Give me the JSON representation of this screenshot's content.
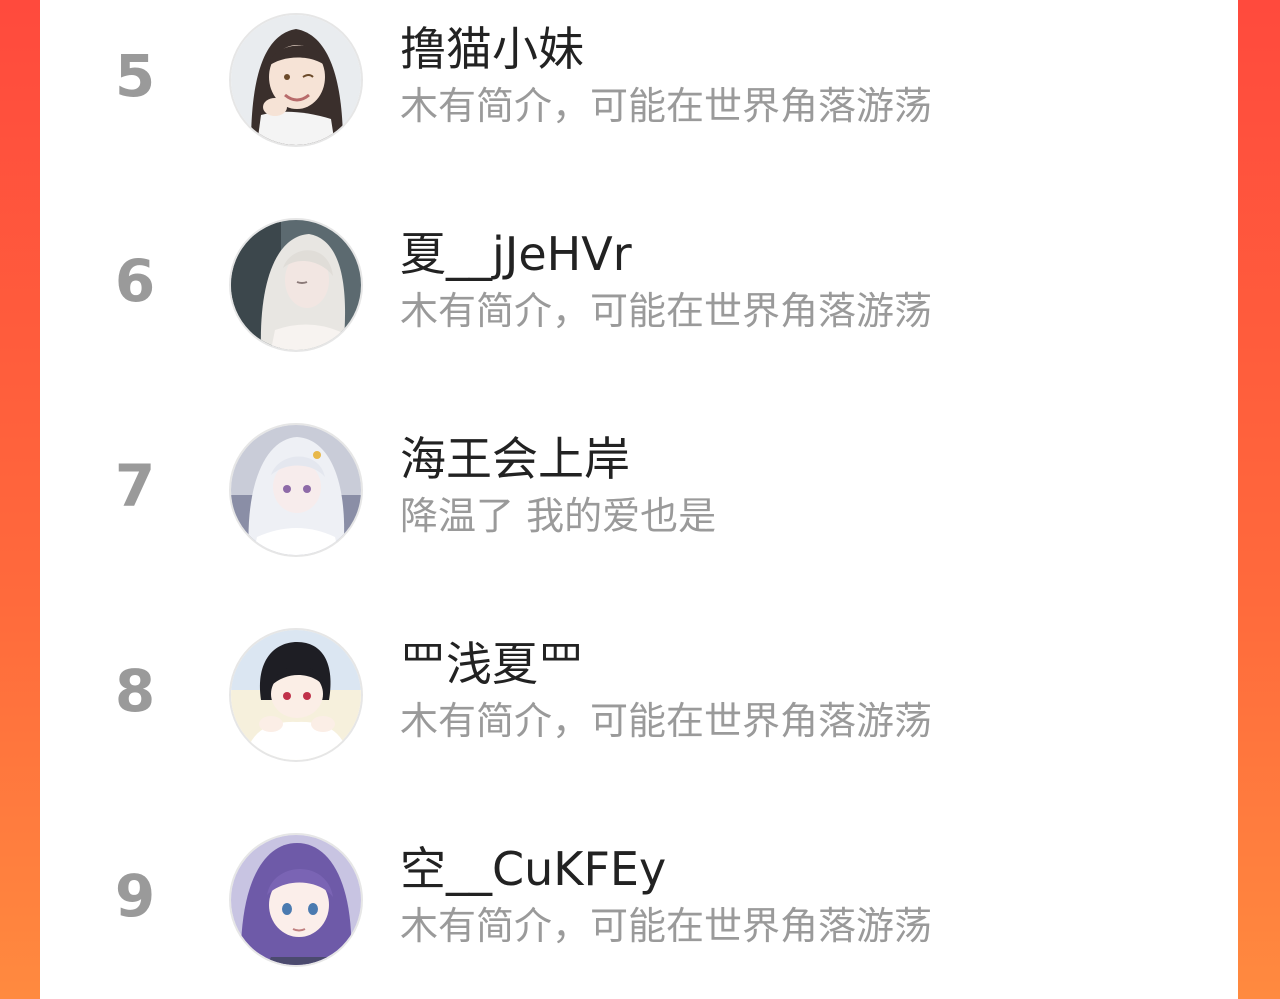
{
  "colors": {
    "background_gradient_top": "#ff4a3d",
    "background_gradient_bottom": "#ff8a3f",
    "rank_color": "#9a9a9a",
    "name_color": "#222222",
    "bio_color": "#9a9a9a"
  },
  "ranking": {
    "items": [
      {
        "rank": "5",
        "name": "撸猫小妹",
        "bio": "木有简介，可能在世界角落游荡",
        "avatar_icon": "avatar-dark-hair-girl"
      },
      {
        "rank": "6",
        "name": "夏__jJeHVr",
        "bio": "木有简介，可能在世界角落游荡",
        "avatar_icon": "avatar-white-hair-character"
      },
      {
        "rank": "7",
        "name": "海王会上岸",
        "bio": "降温了 我的爱也是",
        "avatar_icon": "avatar-white-hair-girl"
      },
      {
        "rank": "8",
        "name": "罒浅夏罒",
        "bio": "木有简介，可能在世界角落游荡",
        "avatar_icon": "avatar-black-hair-boy"
      },
      {
        "rank": "9",
        "name": "空__CuKFEy",
        "bio": "木有简介，可能在世界角落游荡",
        "avatar_icon": "avatar-purple-hair-girl"
      }
    ]
  }
}
